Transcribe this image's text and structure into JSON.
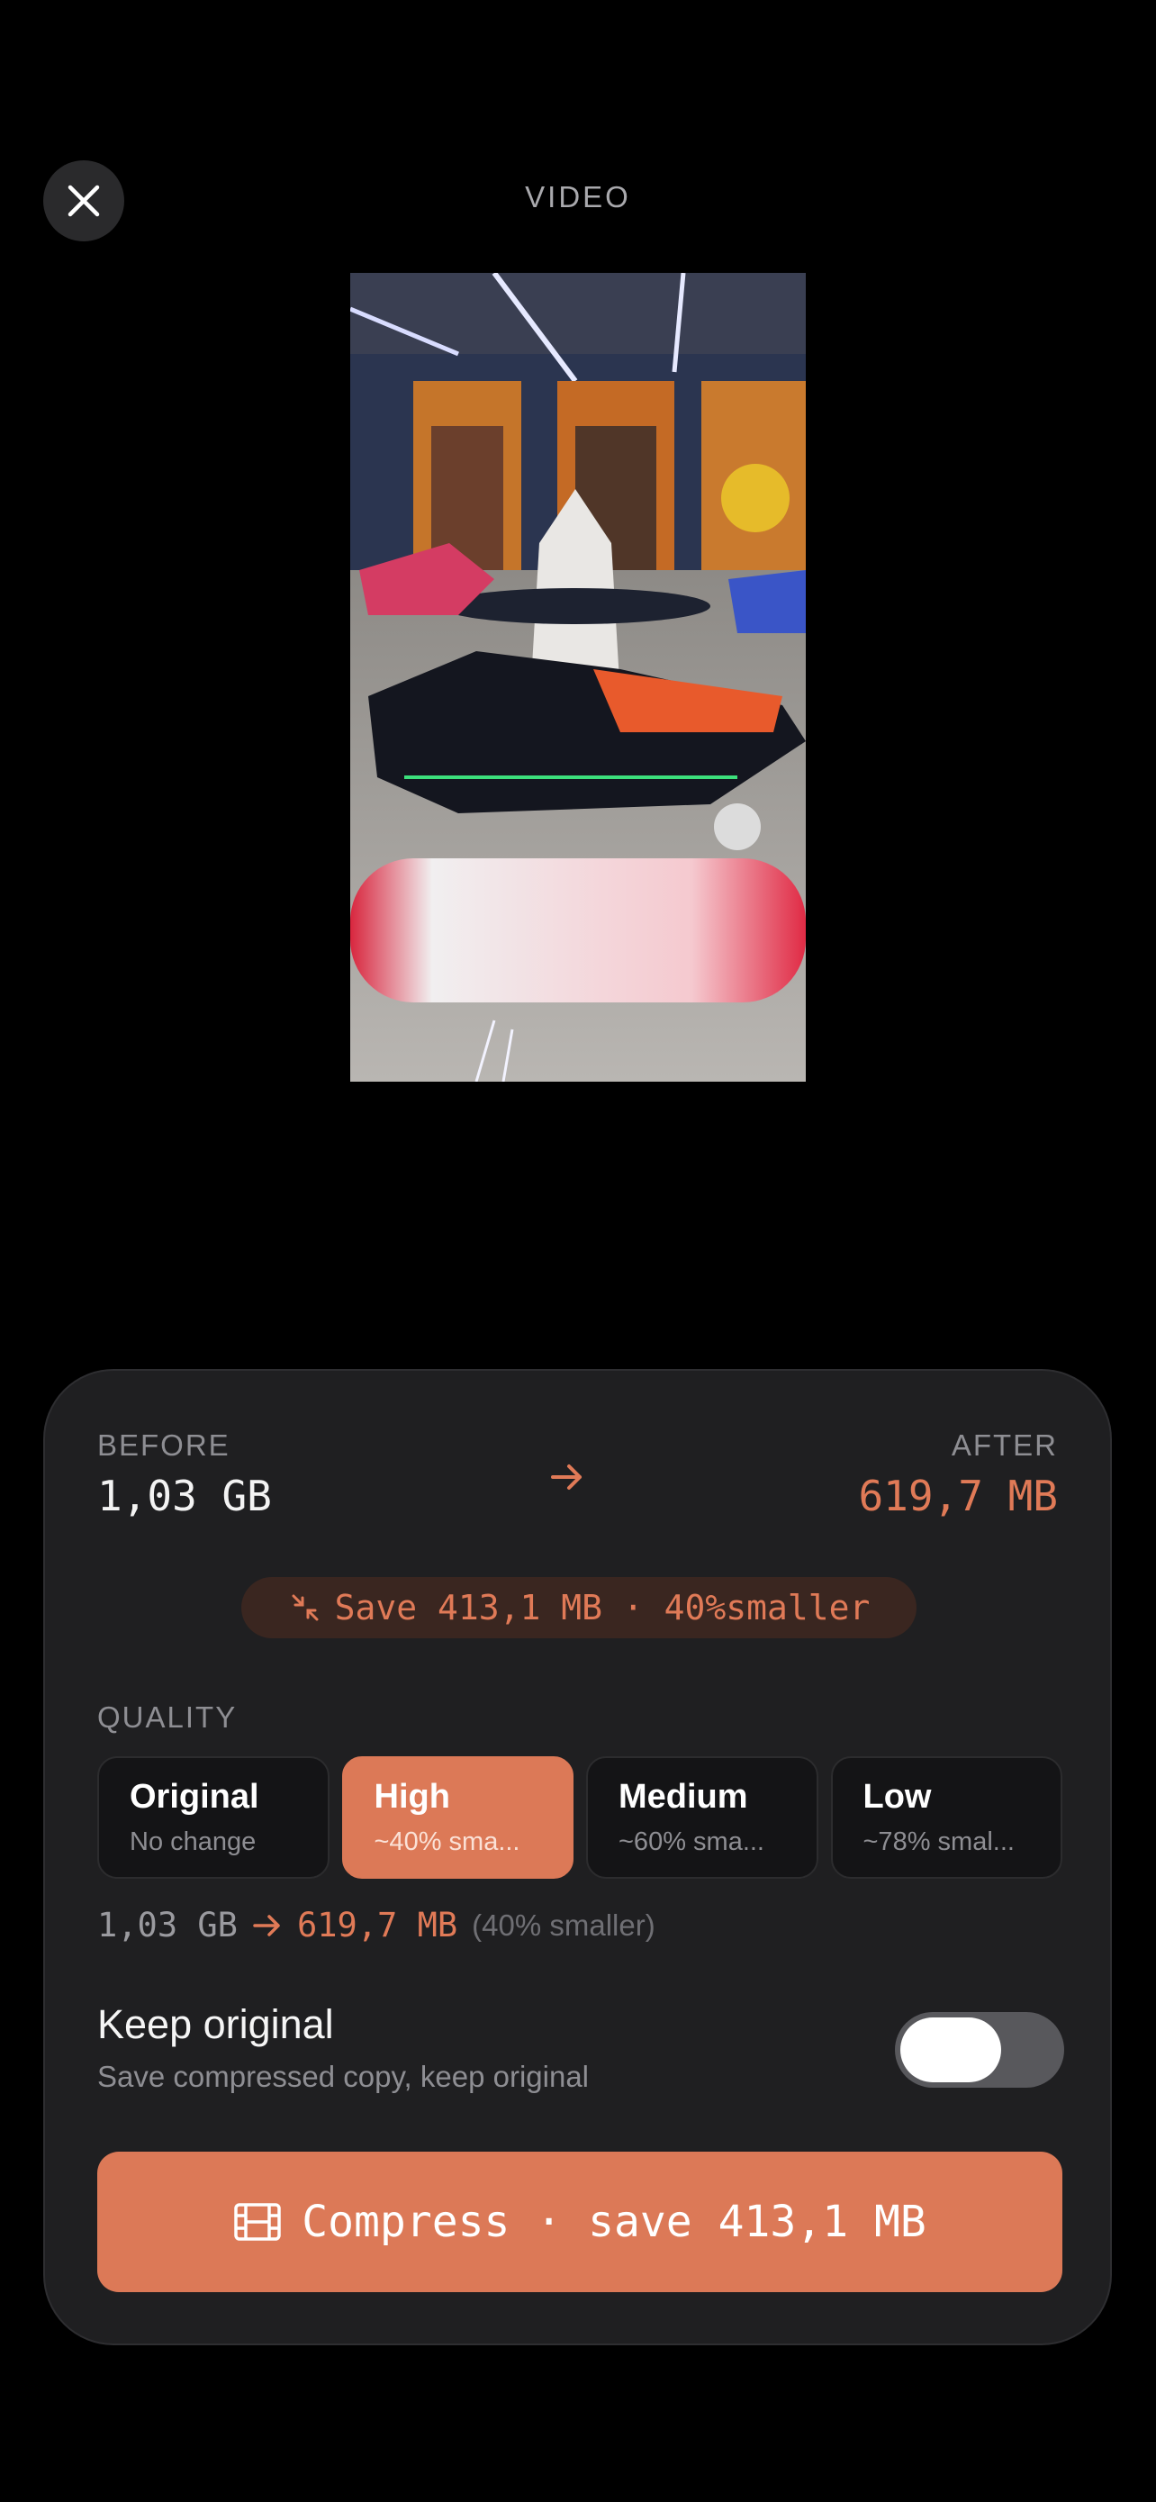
{
  "header": {
    "title": "VIDEO",
    "close_icon": "close-icon"
  },
  "preview": {
    "description_icon": "video-thumbnail"
  },
  "sheet": {
    "before_label": "BEFORE",
    "before_value": "1,03 GB",
    "after_label": "AFTER",
    "after_value": "619,7 MB",
    "savings_pill": "Save 413,1 MB · 40%smaller",
    "quality_label": "QUALITY",
    "quality_options": [
      {
        "title": "Original",
        "subtitle": "No change",
        "selected": false
      },
      {
        "title": "High",
        "subtitle": "~40% sma...",
        "selected": true
      },
      {
        "title": "Medium",
        "subtitle": "~60% sma...",
        "selected": false
      },
      {
        "title": "Low",
        "subtitle": "~78% smal...",
        "selected": false
      }
    ],
    "size_from": "1,03 GB",
    "size_to": "619,7 MB",
    "size_pct": "(40% smaller)",
    "keep_original_title": "Keep original",
    "keep_original_subtitle": "Save compressed copy, keep original",
    "keep_original_on": false,
    "compress_label": "Compress · save 413,1 MB"
  },
  "colors": {
    "accent": "#dc7957",
    "accent_text": "#e07a57",
    "sheet_bg": "#1f1f21"
  }
}
